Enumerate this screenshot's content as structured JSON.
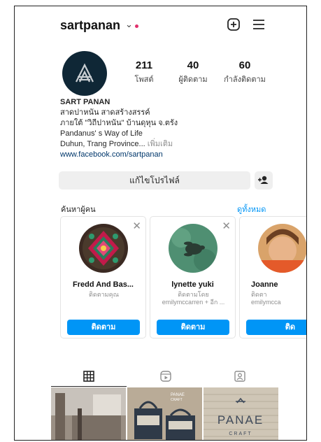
{
  "header": {
    "username": "sartpanan",
    "chevron_icon": "chevron-down-icon",
    "add_icon": "plus-square-icon",
    "menu_icon": "hamburger-menu-icon",
    "notification_color": "#e1306c"
  },
  "profile": {
    "avatar_logo_letter": "A",
    "stats": [
      {
        "value": "211",
        "label": "โพสต์"
      },
      {
        "value": "40",
        "label": "ผู้ติดตาม"
      },
      {
        "value": "60",
        "label": "กำลังติดตาม"
      }
    ],
    "bio": {
      "name": "SART PANAN",
      "line1": "สาดปาหนัน สาดสร้างสรรค์",
      "line2": "ภายใต้ \"วิถีปาหนัน\" บ้านดุหุน จ.ตรัง",
      "line3": "Pandanus' s Way of Life",
      "line4": "Duhun, Trang  Province...",
      "more": "เพิ่มเติม",
      "link": "www.facebook.com/sartpanan"
    },
    "edit_label": "แก้ไขโปรไฟล์"
  },
  "discover": {
    "title": "ค้นหาผู้คน",
    "see_all": "ดูทั้งหมด",
    "cards": [
      {
        "name": "Fredd And Bas...",
        "subtitle": "ติดตามคุณ",
        "subtitle2": "",
        "button": "ติดตาม"
      },
      {
        "name": "lynette yuki",
        "subtitle": "ติดตามโดย",
        "subtitle2": "emilymccarren + อีก ...",
        "button": "ติดตาม"
      },
      {
        "name": "Joanne",
        "subtitle": "ติดตา",
        "subtitle2": "emilymcca",
        "button": "ติด"
      }
    ]
  },
  "tabs": {
    "items": [
      "grid-icon",
      "reels-icon",
      "tagged-icon"
    ]
  },
  "grid": {
    "tile2_text": "PANAE\nCRAFT\nSart Dunhun\nTHE\nMEMO",
    "tile3_text": "PANAE",
    "tile3_sub": "CRAFT"
  },
  "colors": {
    "accent": "#0095f6",
    "link": "#00376b",
    "avatar_bg": "#0f2736"
  }
}
